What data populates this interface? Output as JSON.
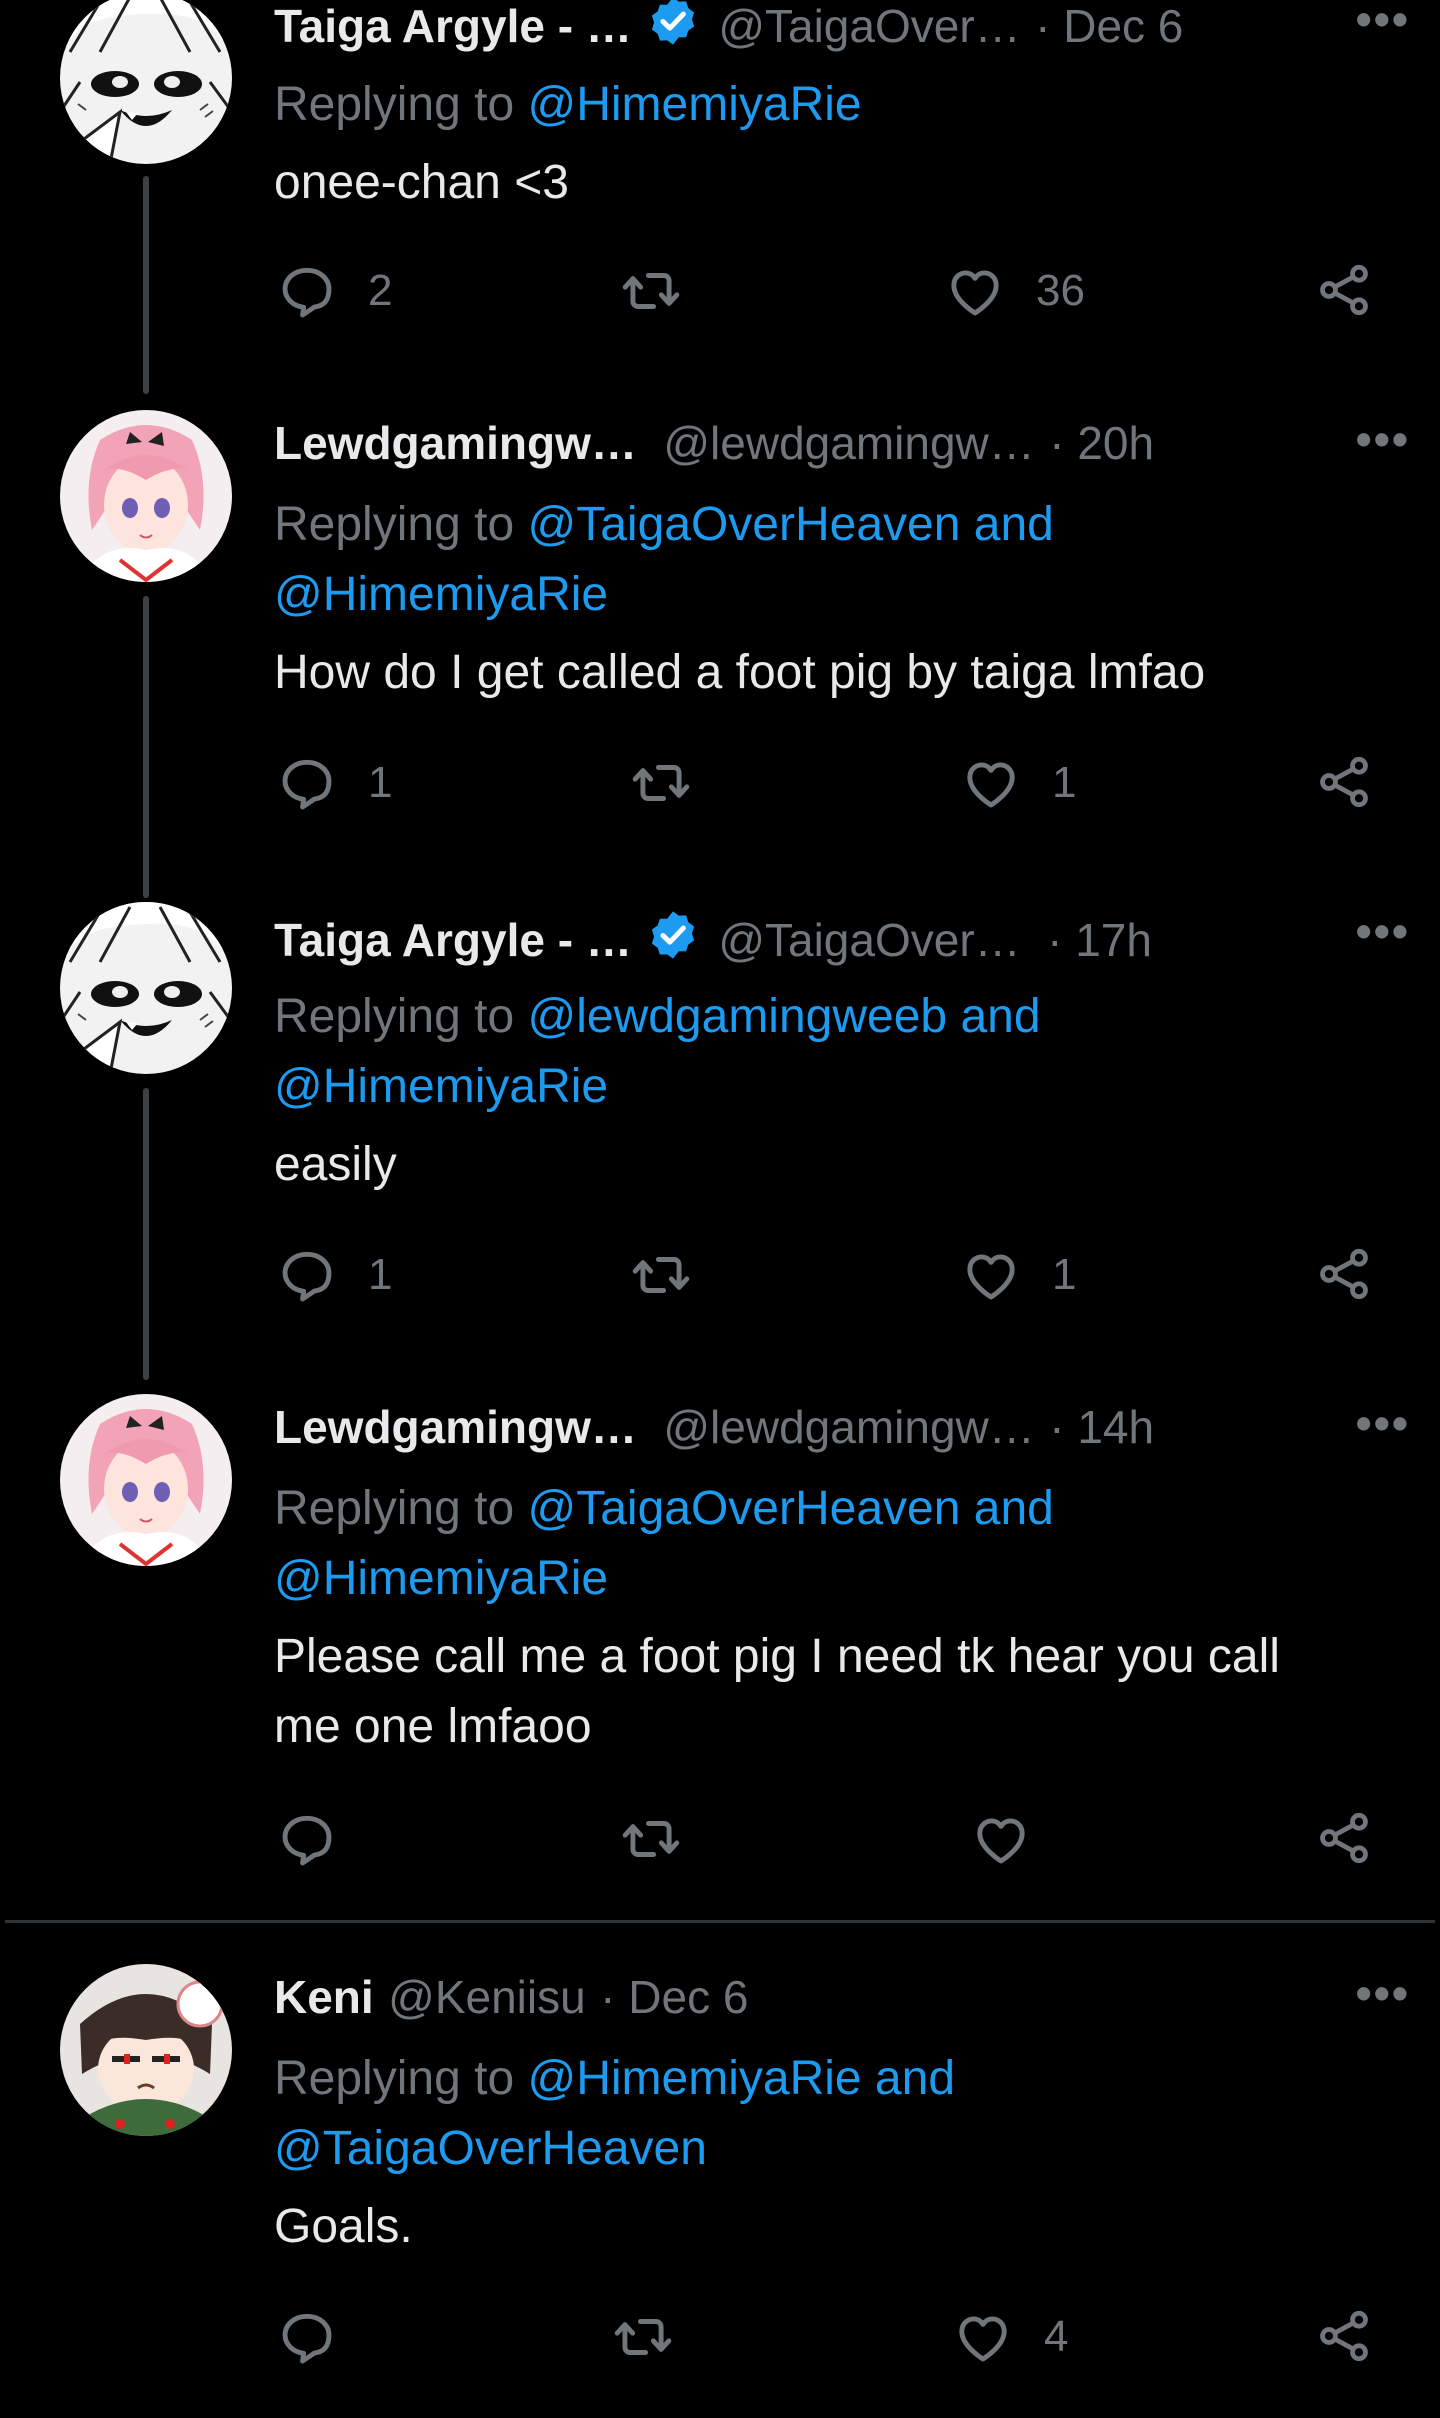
{
  "colors": {
    "background": "#000000",
    "text": "#e7e9ea",
    "muted": "#71767b",
    "link": "#1d9bf0",
    "verified": "#1d9bf0"
  },
  "tweets": [
    {
      "name": "Taiga Argyle - …",
      "verified": true,
      "handle": "@TaigaOver…",
      "time": "· Dec 6",
      "replying_prefix": "Replying to ",
      "replying_line1": "@HimemiyaRie",
      "replying_line2": "",
      "text": "onee-chan <3",
      "replies": "2",
      "retweets": "",
      "likes": "36",
      "avatar": "manga-girl-avatar"
    },
    {
      "name": "Lewdgamingw…",
      "verified": false,
      "handle": "@lewdgamingw…",
      "time": "· 20h",
      "replying_prefix": "Replying to ",
      "replying_line1": "@TaigaOverHeaven and",
      "replying_line2": "@HimemiyaRie",
      "text": "How do I get called a foot pig by taiga lmfao",
      "replies": "1",
      "retweets": "",
      "likes": "1",
      "avatar": "pink-hair-anime-avatar"
    },
    {
      "name": "Taiga Argyle - …",
      "verified": true,
      "handle": "@TaigaOver…",
      "time": "· 17h",
      "replying_prefix": "Replying to ",
      "replying_line1": "@lewdgamingweeb and",
      "replying_line2": "@HimemiyaRie",
      "text": "easily",
      "replies": "1",
      "retweets": "",
      "likes": "1",
      "avatar": "manga-girl-avatar"
    },
    {
      "name": "Lewdgamingw…",
      "verified": false,
      "handle": "@lewdgamingw…",
      "time": "· 14h",
      "replying_prefix": "Replying to ",
      "replying_line1": "@TaigaOverHeaven and",
      "replying_line2": "@HimemiyaRie",
      "text_line1": "Please call me a foot pig I need tk hear you call",
      "text_line2": "me one lmfaoo",
      "replies": "",
      "retweets": "",
      "likes": "",
      "avatar": "pink-hair-anime-avatar"
    },
    {
      "name": "Keni",
      "verified": false,
      "handle": "@Keniisu",
      "time": "· Dec 6",
      "replying_prefix": "Replying to ",
      "replying_line1": "@HimemiyaRie and",
      "replying_line2": "@TaigaOverHeaven",
      "text": "Goals.",
      "replies": "",
      "retweets": "",
      "likes": "4",
      "avatar": "chibi-character-avatar"
    }
  ]
}
